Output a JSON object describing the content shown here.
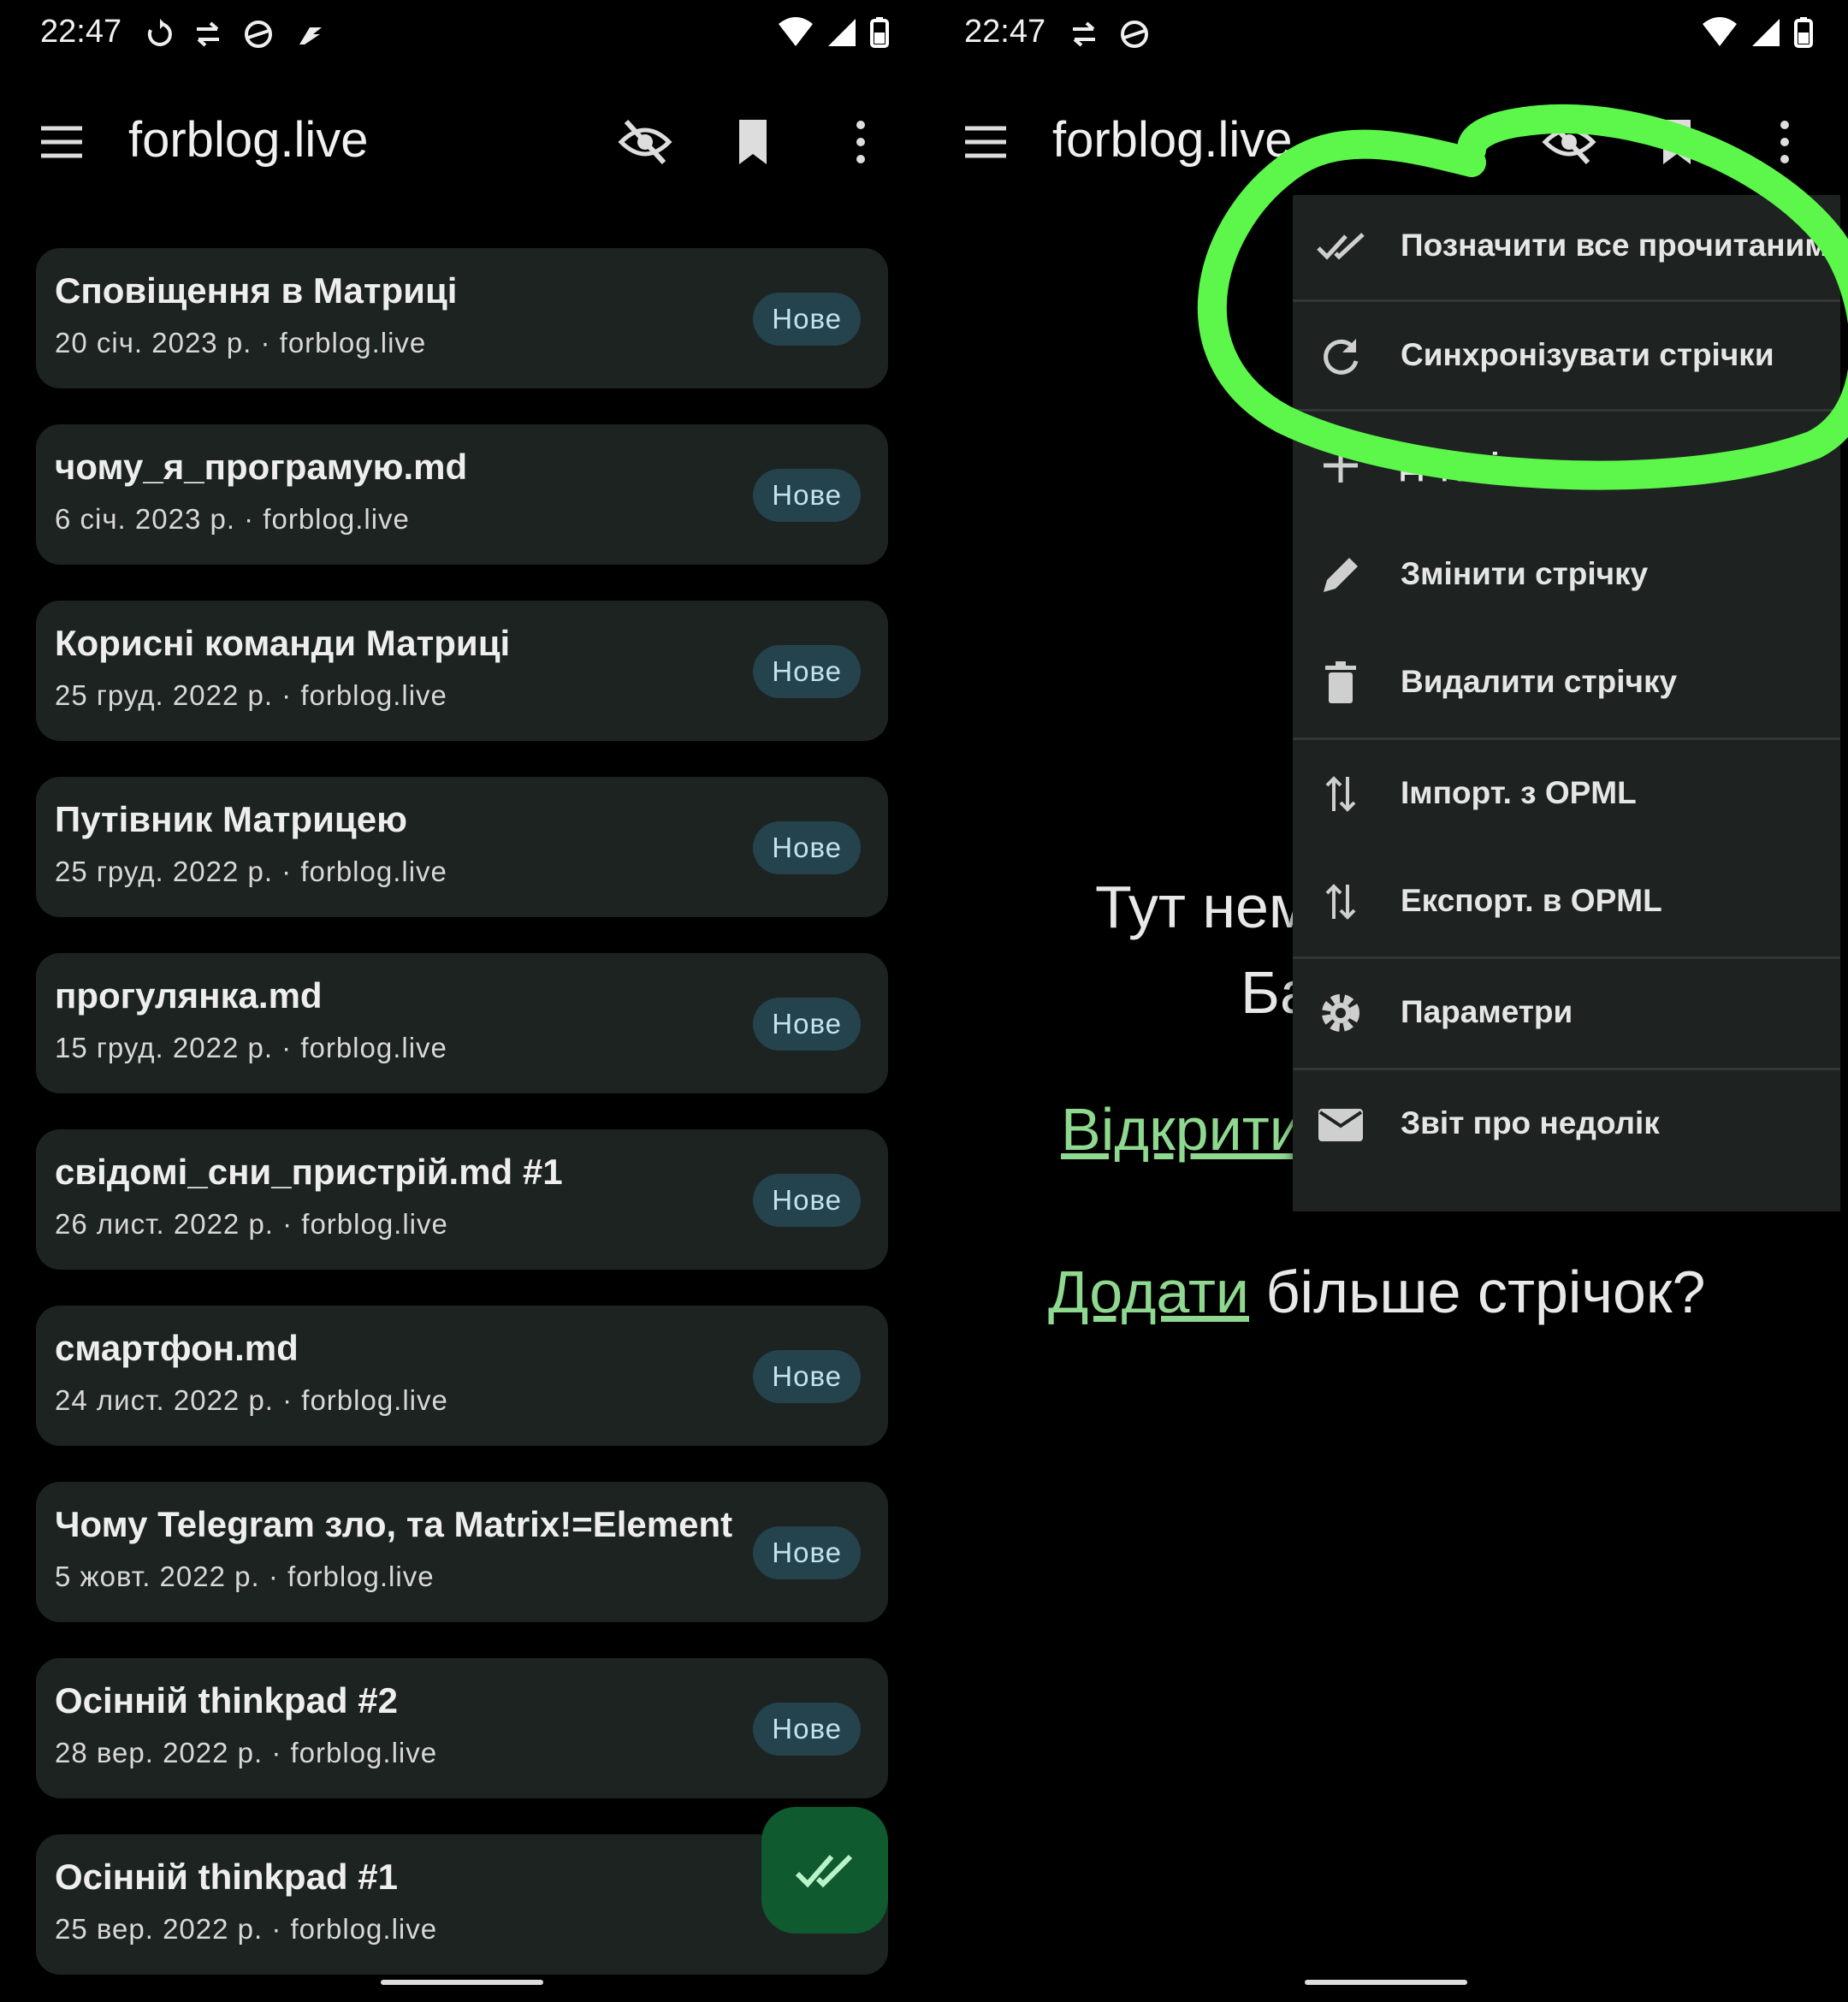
{
  "left": {
    "status": {
      "time": "22:47"
    },
    "toolbar": {
      "title": "forblog.live"
    },
    "articles": [
      {
        "title": "Сповіщення в Матриці",
        "meta": "20 січ. 2023 р. · forblog.live",
        "badge": "Нове"
      },
      {
        "title": "чому_я_програмую.md",
        "meta": "6 січ. 2023 р. · forblog.live",
        "badge": "Нове"
      },
      {
        "title": "Корисні команди Матриці",
        "meta": "25 груд. 2022 р. · forblog.live",
        "badge": "Нове"
      },
      {
        "title": "Путівник Матрицею",
        "meta": "25 груд. 2022 р. · forblog.live",
        "badge": "Нове"
      },
      {
        "title": "прогулянка.md",
        "meta": "15 груд. 2022 р. · forblog.live",
        "badge": "Нове"
      },
      {
        "title": "свідомі_сни_пристрій.md #1",
        "meta": "26 лист. 2022 р. · forblog.live",
        "badge": "Нове"
      },
      {
        "title": "смартфон.md",
        "meta": "24 лист. 2022 р. · forblog.live",
        "badge": "Нове"
      },
      {
        "title": "Чому Telegram зло, та Matrix!=Element",
        "meta": "5 жовт. 2022 р. · forblog.live",
        "badge": "Нове"
      },
      {
        "title": "Осінній thinkpad #2",
        "meta": "28 вер. 2022 р. · forblog.live",
        "badge": "Нове"
      },
      {
        "title": "Осінній thinkpad #1",
        "meta": "25 вер. 2022 р. · forblog.live",
        "badge": ""
      }
    ]
  },
  "right": {
    "status": {
      "time": "22:47"
    },
    "toolbar": {
      "title": "forblog.live"
    },
    "empty": {
      "line1": "Тут нем",
      "line2": "Ба",
      "open_link": "Відкрити",
      "add_link": "Додати",
      "add_rest": " більше стрічок?"
    },
    "menu": [
      {
        "label": "Позначити все прочитаним",
        "icon": "double-check-icon"
      },
      {
        "label": "Синхронізувати стрічки",
        "icon": "refresh-icon"
      },
      {
        "label": "Дод             рі  у",
        "icon": "plus-icon"
      },
      {
        "label": "Змінити стрічку",
        "icon": "pencil-icon"
      },
      {
        "label": "Видалити стрічку",
        "icon": "trash-icon"
      },
      {
        "label": "Імпорт. з OPML",
        "icon": "import-arrows-icon"
      },
      {
        "label": "Експорт. в OPML",
        "icon": "export-arrows-icon"
      },
      {
        "label": "Параметри",
        "icon": "gear-icon"
      },
      {
        "label": "Звіт про недолік",
        "icon": "mail-icon"
      }
    ]
  },
  "colors": {
    "accent": "#8fd88f",
    "card": "#1d2321",
    "badge": "#24434d",
    "fab": "#0f5a2e",
    "annotation": "#5cf74a"
  }
}
